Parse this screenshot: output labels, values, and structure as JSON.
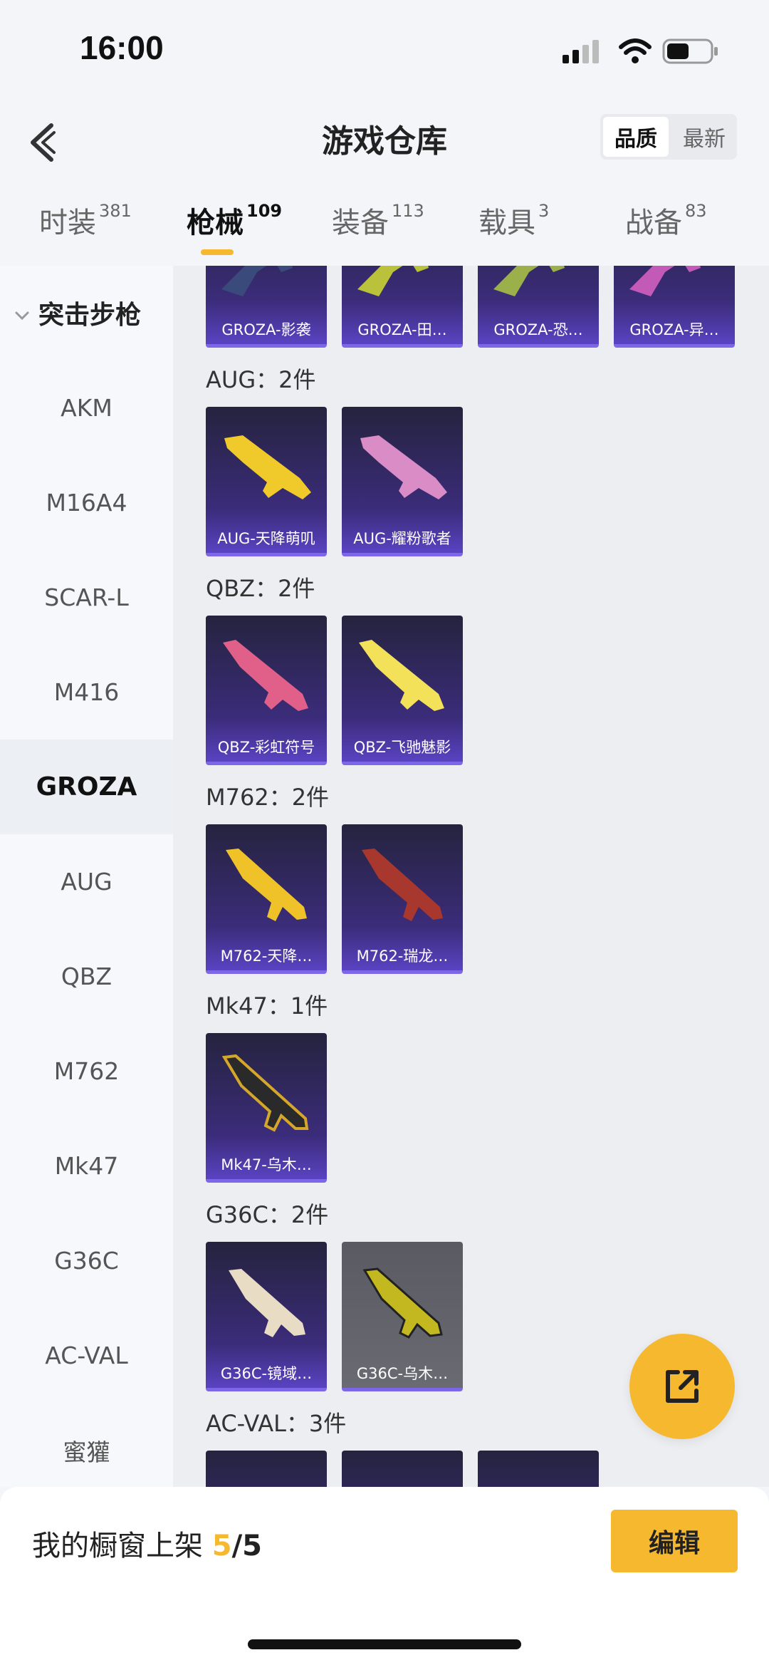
{
  "status_bar": {
    "time": "16:00"
  },
  "header": {
    "title": "游戏仓库",
    "sort_options": [
      "品质",
      "最新"
    ],
    "sort_active": "品质"
  },
  "tabs": [
    {
      "label": "时装",
      "count": "381"
    },
    {
      "label": "枪械",
      "count": "109",
      "active": true
    },
    {
      "label": "装备",
      "count": "113"
    },
    {
      "label": "载具",
      "count": "3"
    },
    {
      "label": "战备",
      "count": "83"
    }
  ],
  "sidebar": {
    "category": "突击步枪",
    "items": [
      "AKM",
      "M16A4",
      "SCAR-L",
      "M416",
      "GROZA",
      "AUG",
      "QBZ",
      "M762",
      "Mk47",
      "G36C",
      "AC-VAL",
      "蜜獾"
    ],
    "active": "GROZA"
  },
  "content": {
    "groza_cards": [
      "GROZA-影袭",
      "GROZA-田…",
      "GROZA-恐…",
      "GROZA-异…"
    ],
    "groups": [
      {
        "label": "AUG：2件",
        "cards": [
          "AUG-天降萌叽",
          "AUG-耀粉歌者"
        ]
      },
      {
        "label": "QBZ：2件",
        "cards": [
          "QBZ-彩虹符号",
          "QBZ-飞驰魅影"
        ]
      },
      {
        "label": "M762：2件",
        "cards": [
          "M762-天降…",
          "M762-瑞龙…"
        ]
      },
      {
        "label": "Mk47：1件",
        "cards": [
          "Mk47-乌木…"
        ]
      },
      {
        "label": "G36C：2件",
        "cards": [
          "G36C-镜域…",
          "G36C-乌木…"
        ]
      },
      {
        "label": "AC-VAL：3件",
        "cards": []
      }
    ]
  },
  "bottom_bar": {
    "showcase_label": "我的橱窗上架",
    "showcase_current": "5",
    "showcase_total": "/5",
    "edit_label": "编辑"
  },
  "colors": {
    "accent": "#f5b82e",
    "card_top": "#25233e",
    "card_bottom": "#5a43c2"
  }
}
